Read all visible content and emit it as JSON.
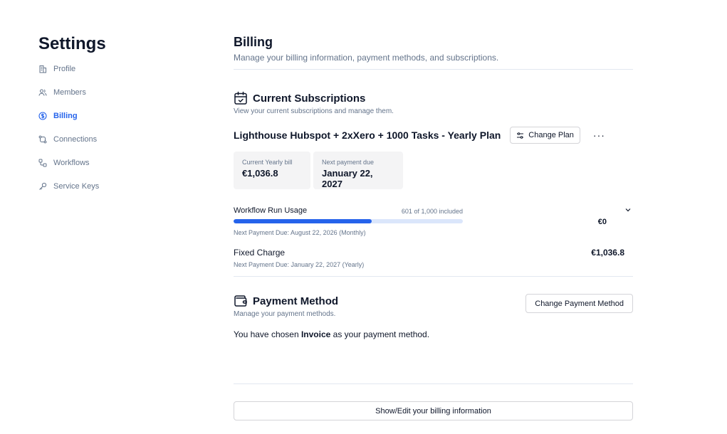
{
  "sidebar": {
    "title": "Settings",
    "items": [
      {
        "label": "Profile",
        "icon": "building-icon",
        "active": false
      },
      {
        "label": "Members",
        "icon": "users-icon",
        "active": false
      },
      {
        "label": "Billing",
        "icon": "dollar-circle-icon",
        "active": true
      },
      {
        "label": "Connections",
        "icon": "connections-icon",
        "active": false
      },
      {
        "label": "Workflows",
        "icon": "workflow-icon",
        "active": false
      },
      {
        "label": "Service Keys",
        "icon": "key-icon",
        "active": false
      }
    ]
  },
  "header": {
    "title": "Billing",
    "subtitle": "Manage your billing information, payment methods, and subscriptions."
  },
  "subscriptions": {
    "title": "Current Subscriptions",
    "subtitle": "View your current subscriptions and manage them.",
    "plan_name": "Lighthouse Hubspot + 2xXero + 1000 Tasks - Yearly Plan",
    "change_plan_label": "Change Plan",
    "more_label": "···",
    "cards": [
      {
        "label": "Current Yearly bill",
        "value": "€1,036.8"
      },
      {
        "label": "Next payment due",
        "value": "January 22, 2027"
      }
    ],
    "usage": {
      "label": "Workflow Run Usage",
      "count_text": "601 of 1,000 included",
      "used": 601,
      "included": 1000,
      "next_payment": "Next Payment Due: August 22, 2026 (Monthly)",
      "amount": "€0"
    },
    "fixed": {
      "label": "Fixed Charge",
      "amount": "€1,036.8",
      "next_payment": "Next Payment Due: January 22, 2027 (Yearly)"
    }
  },
  "payment": {
    "title": "Payment Method",
    "subtitle": "Manage your payment methods.",
    "change_label": "Change Payment Method",
    "text_before": "You have chosen ",
    "method": "Invoice",
    "text_after": " as your payment method."
  },
  "billing_info_button": "Show/Edit your billing information",
  "colors": {
    "accent": "#2563eb",
    "bar_track": "#dbe6fb",
    "muted_text": "#64748b",
    "card_bg": "#f4f4f5"
  }
}
